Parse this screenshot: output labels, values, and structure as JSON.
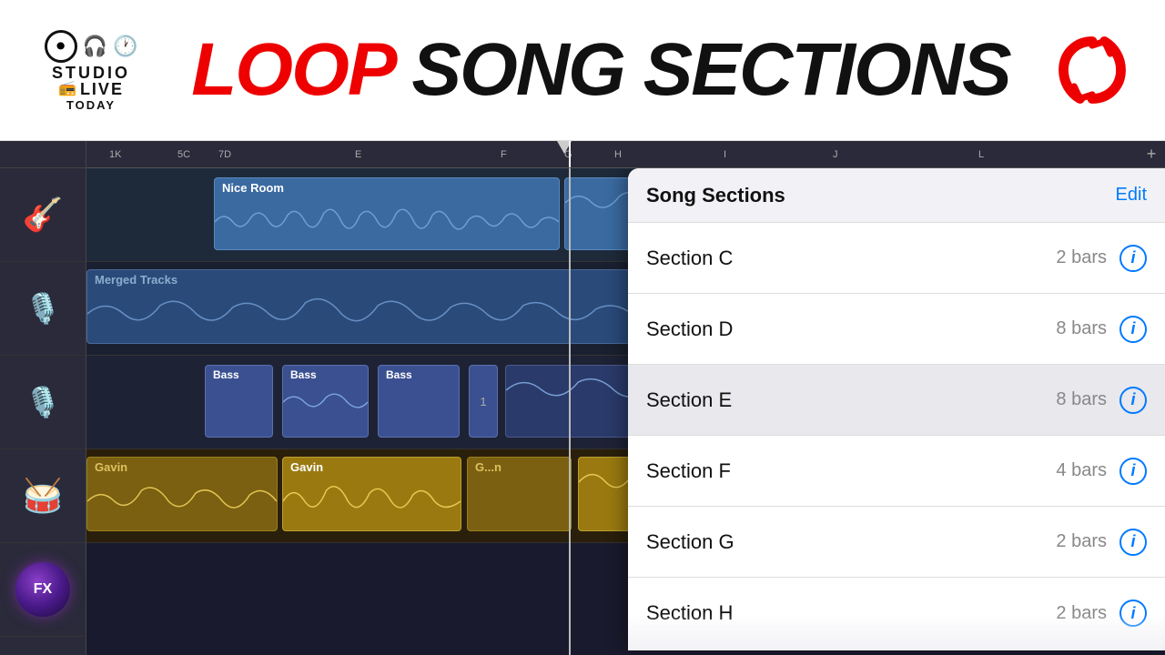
{
  "header": {
    "logo": {
      "studio": "STUDIO",
      "live": "LIVE",
      "today": "TODAY"
    },
    "title": {
      "loop": "Loop",
      "rest": " Song Sections"
    }
  },
  "ruler": {
    "marks": [
      "1K",
      "5C",
      "7D",
      "E",
      "F",
      "G",
      "H",
      "I",
      "J",
      "L"
    ],
    "add_button": "+"
  },
  "tracks": [
    {
      "name": "Nice Room",
      "type": "guitar",
      "icon": "🎸"
    },
    {
      "name": "Merged Tracks",
      "type": "vocal",
      "icon": "🎤"
    },
    {
      "name": "Bass",
      "type": "bass",
      "icon": "🎤"
    },
    {
      "name": "Gavin",
      "type": "drums",
      "icon": "🥁"
    }
  ],
  "panel": {
    "title": "Song Sections",
    "edit_label": "Edit",
    "sections": [
      {
        "name": "Section C",
        "bars": "2 bars"
      },
      {
        "name": "Section D",
        "bars": "8 bars"
      },
      {
        "name": "Section E",
        "bars": "8 bars",
        "active": true
      },
      {
        "name": "Section F",
        "bars": "4 bars"
      },
      {
        "name": "Section G",
        "bars": "2 bars"
      },
      {
        "name": "Section H",
        "bars": "2 bars"
      }
    ]
  },
  "clips": {
    "nice_room": "Nice Room",
    "merged": "Merged Tracks",
    "bass": "Bass",
    "gavin": "Gavin",
    "bass_num": "1",
    "gavin_short": "G...n"
  }
}
